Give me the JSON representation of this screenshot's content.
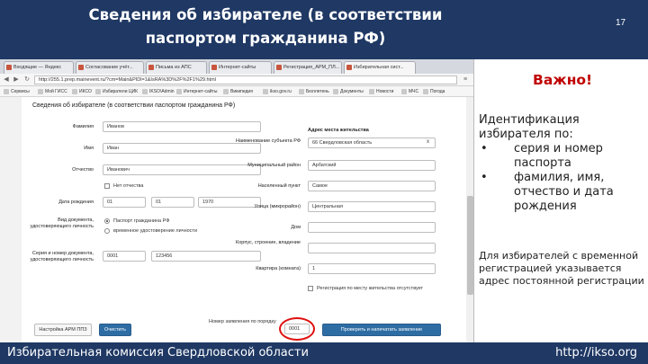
{
  "slide": {
    "title": "Сведения об избирателе (в соответствии паспортом гражданина РФ)",
    "number": "17",
    "footer_left": "Избирательная комиссия Свердловской области",
    "footer_right": "http://ikso.org"
  },
  "notes": {
    "important": "Важно!",
    "intro": "Идентификация избирателя по:",
    "bullets": [
      "серия и номер паспорта",
      "фамилия, имя, отчество и дата рождения"
    ],
    "temp_reg": "Для избирателей с временной регистрацией указывается адрес постоянной регистрации"
  },
  "browser": {
    "tabs": [
      "Входящие — Яндекс",
      "Согласование учёт...",
      "Письма из АПС",
      "Интернет-сайты",
      "Регистрация_АРМ_ПЛ...",
      "Избирательная сист..."
    ],
    "url": "http://255.1.prep.mainevent.ru/?cm=Main&PIDl=1&IsRA%3D%2F%2F1%29.html",
    "bookmarks": [
      "Сервисы",
      "Мой ГИСС",
      "ИКСО",
      "Избиратели ЦИК",
      "IKSO\\Admin",
      "Интернет-сайты",
      "Википедия",
      "ikso.gov.ru",
      "Бюллетень",
      "Документы",
      "Новости",
      "МЧС",
      "Погода"
    ]
  },
  "form": {
    "title": "Сведения об избирателе (в соответствии паспортом гражданина РФ)",
    "surname_label": "Фамилия",
    "surname_value": "Иванов",
    "name_label": "Имя",
    "name_value": "Иван",
    "patronymic_label": "Отчество",
    "patronymic_value": "Иванович",
    "no_patronymic": "Нет отчества",
    "dob_label": "Дата рождения",
    "dob_day": "01",
    "dob_month": "01",
    "dob_year": "1970",
    "doc_type_label": "Вид документа, удостоверяющего личность",
    "doc_option_1": "Паспорт гражданина РФ",
    "doc_option_2": "временное удостоверение личности",
    "doc_series_label": "Серия и номер документа, удостоверяющего личность",
    "doc_series": "0001",
    "doc_number": "123456",
    "address_header": "Адрес места жительства",
    "subject_label": "Наименование субъекта РФ",
    "subject_value": "66 Свердловская область",
    "district_label": "Муниципальный район",
    "district_value": "Арбатский",
    "settlement_label": "Населенный пункт",
    "settlement_value": "Самое",
    "street_label": "Улица (микрорайон)",
    "street_value": "Центральная",
    "house_label": "Дом",
    "house_value": "",
    "building_label": "Корпус, строение, владение",
    "building_value": "",
    "apartment_label": "Квартира (комната)",
    "apartment_value": "1",
    "reg_missing": "Регистрация по месту жительства отсутствует",
    "btn_settings": "Настройка АРМ ППЗ",
    "btn_clear": "Очистить",
    "order_label": "Номер заявления по порядку",
    "order_value": "0001",
    "btn_check": "Проверить и напечатать заявление"
  }
}
